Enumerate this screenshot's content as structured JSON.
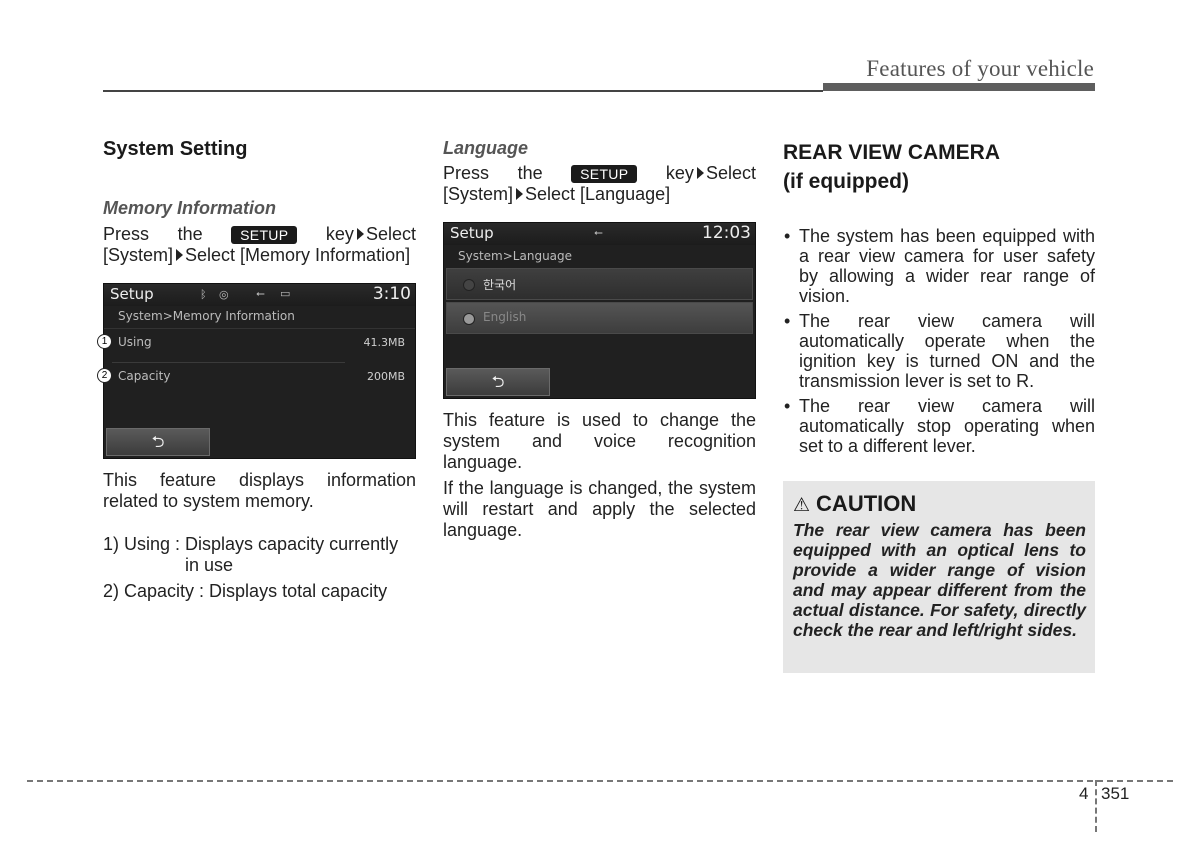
{
  "header": {
    "title": "Features of your vehicle"
  },
  "col1": {
    "heading": "System Setting",
    "subheading": "Memory Information",
    "instr_line1_a": "Press",
    "instr_line1_b": "the",
    "setup_key": "SETUP",
    "instr_line1_c": "key",
    "instr_line1_d": "Select",
    "instr_line2_a": "[System]",
    "instr_line2_b": "Select [Memory Information]",
    "screen": {
      "title": "Setup",
      "time": "3:10",
      "status_icons": [
        "bluetooth-icon",
        "disc-icon",
        "usb-icon",
        "battery-icon"
      ],
      "breadcrumb": "System>Memory Information",
      "rows": [
        {
          "marker": "1",
          "label": "Using",
          "value": "41.3MB"
        },
        {
          "marker": "2",
          "label": "Capacity",
          "value": "200MB"
        }
      ],
      "back_label": "⮌"
    },
    "desc": "This feature displays information related to system memory.",
    "list": [
      {
        "term": "1) Using :",
        "def": "Displays capacity currently in use"
      },
      {
        "term": "2) Capacity :",
        "def": "Displays total capacity"
      }
    ]
  },
  "col2": {
    "subheading": "Language",
    "instr_line1_a": "Press",
    "instr_line1_b": "the",
    "setup_key": "SETUP",
    "instr_line1_c": "key",
    "instr_line1_d": "Select",
    "instr_line2_a": "[System]",
    "instr_line2_b": "Select [Language]",
    "screen": {
      "title": "Setup",
      "time": "12:03",
      "status_icons": [
        "usb-icon"
      ],
      "breadcrumb": "System>Language",
      "options": [
        {
          "label": "한국어",
          "selected": false
        },
        {
          "label": "English",
          "selected": true
        }
      ],
      "back_label": "⮌"
    },
    "desc1": "This feature is used to change the system and voice recognition language.",
    "desc2": "If the language is changed, the system will restart and apply the selected language."
  },
  "col3": {
    "heading_line1": "REAR VIEW CAMERA",
    "heading_line2": "(if equipped)",
    "bullets": [
      "The system has been equipped with a rear view camera for user safety by allowing a wider rear range of vision.",
      "The rear view camera will automatically operate when the ignition key is turned ON and the transmission lever is set to R.",
      "The rear view camera will automatically stop operating when set to a different lever."
    ],
    "caution": {
      "icon": "⚠",
      "title": "CAUTION",
      "body": "The rear view camera has been equipped with an optical lens to provide a wider range of vision and may appear different from the actual distance. For safety, directly check the rear and left/right sides."
    }
  },
  "footer": {
    "chapter": "4",
    "page": "351"
  }
}
